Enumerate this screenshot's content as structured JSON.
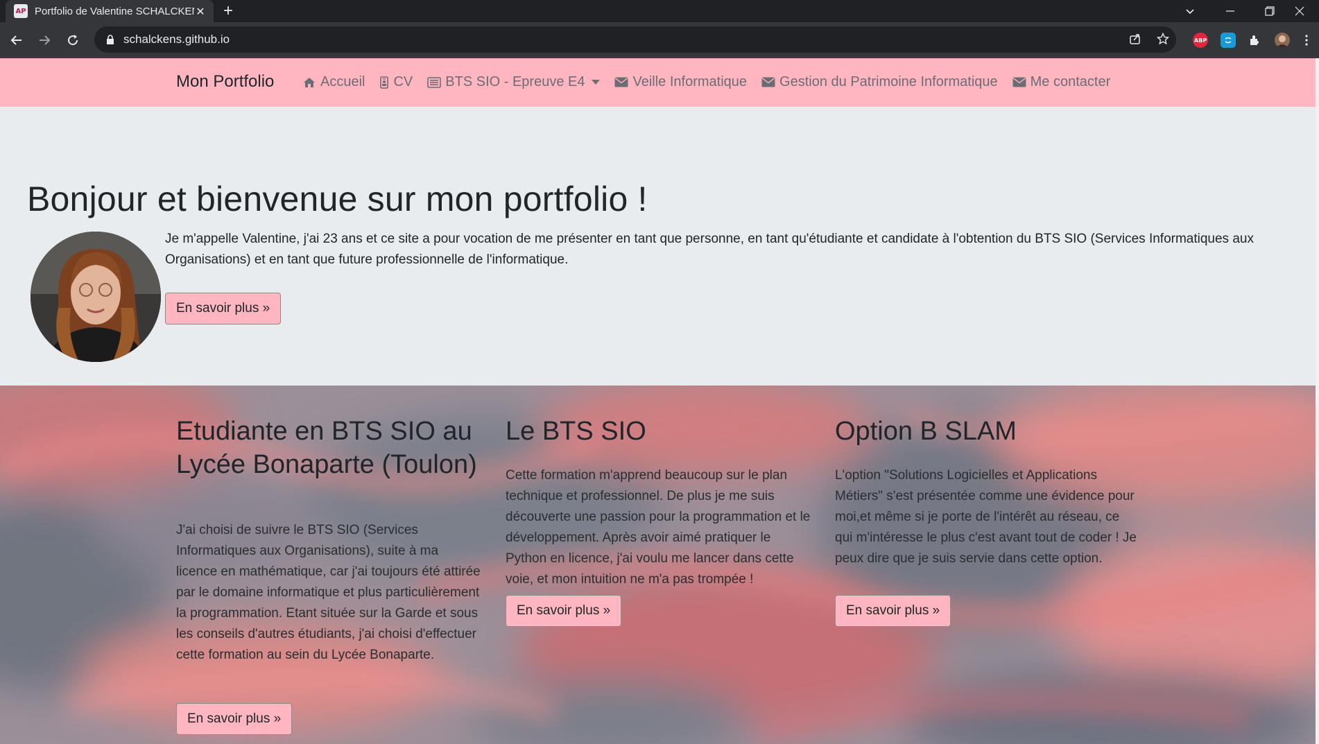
{
  "browser": {
    "tab_title": "Portfolio de Valentine SCHALCKENS",
    "favicon_text": "AP",
    "url": "schalckens.github.io",
    "extensions": [
      {
        "name": "adblock-plus-icon",
        "label": "ABP",
        "color": "#e3263b"
      },
      {
        "name": "translate-extension-icon",
        "label": "",
        "color": "#1a9bd7"
      }
    ]
  },
  "navbar": {
    "brand": "Mon Portfolio",
    "items": [
      {
        "label": "Accueil",
        "icon": "home-icon"
      },
      {
        "label": "CV",
        "icon": "id-badge-icon"
      },
      {
        "label": "BTS SIO - Epreuve E4",
        "icon": "list-alt-icon",
        "dropdown": true
      },
      {
        "label": "Veille Informatique",
        "icon": "envelope-icon"
      },
      {
        "label": "Gestion du Patrimoine Informatique",
        "icon": "envelope-icon"
      },
      {
        "label": "Me contacter",
        "icon": "envelope-icon"
      }
    ]
  },
  "jumbotron": {
    "heading": "Bonjour et bienvenue sur mon portfolio !",
    "intro": "Je m'appelle Valentine, j'ai 23 ans et ce site a pour vocation de me présenter en tant que personne, en tant qu'étudiante et candidate à l'obtention du BTS SIO (Services Informatiques aux Organisations) et en tant que future professionnelle de l'informatique.",
    "button": "En savoir plus »"
  },
  "features": [
    {
      "title": "Etudiante en BTS SIO au Lycée Bonaparte (Toulon)",
      "text": "J'ai choisi de suivre le BTS SIO (Services Informatiques aux Organisations), suite à ma licence en mathématique, car j'ai toujours été attirée par le domaine informatique et plus particulièrement la programmation. Etant située sur la Garde et sous les conseils d'autres étudiants, j'ai choisi d'effectuer cette formation au sein du Lycée Bonaparte.",
      "button": "En savoir plus »"
    },
    {
      "title": "Le BTS SIO",
      "text": "Cette formation m'apprend beaucoup sur le plan technique et professionnel. De plus je me suis découverte une passion pour la programmation et le développement. Après avoir aimé pratiquer le Python en licence, j'ai voulu me lancer dans cette voie, et mon intuition ne m'a pas trompée !",
      "button": "En savoir plus »"
    },
    {
      "title": "Option B SLAM",
      "text": "L'option \"Solutions Logicielles et Applications Métiers\" s'est présentée comme une évidence pour moi,et même si je porte de l'intérêt au réseau, ce qui m'intéresse le plus c'est avant tout de coder ! Je peux dire que je suis servie dans cette option.",
      "button": "En savoir plus »"
    }
  ],
  "colors": {
    "navbar_bg": "#ffb6c1",
    "button_bg": "#ffb6c1",
    "jumbotron_bg": "#e9ecef"
  }
}
